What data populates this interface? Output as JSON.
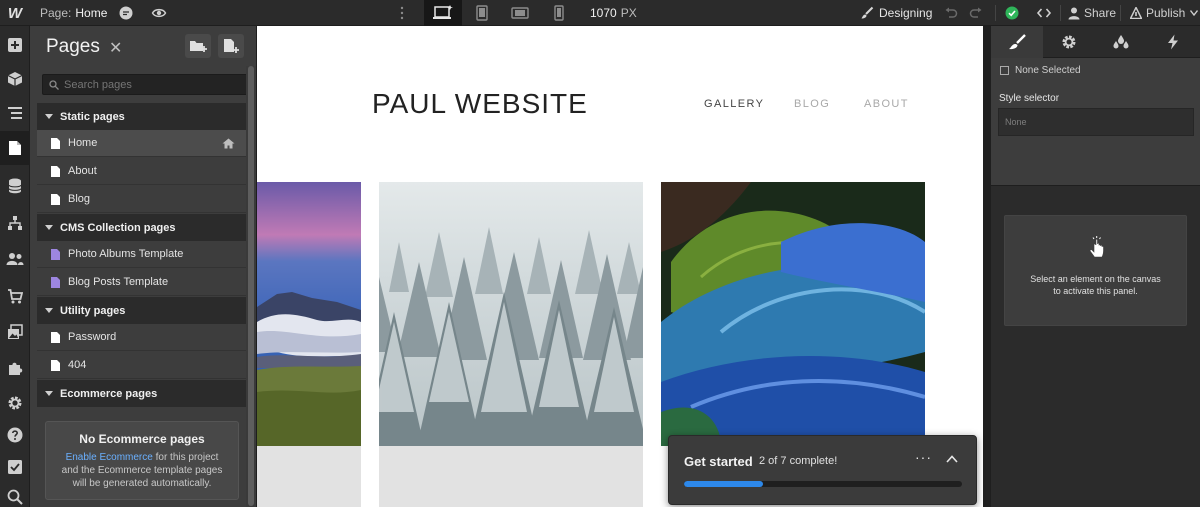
{
  "topbar": {
    "logo": "W",
    "page_prefix": "Page:",
    "page_name": "Home",
    "canvas_width": "1070",
    "canvas_unit": "PX",
    "mode_label": "Designing",
    "share_label": "Share",
    "publish_label": "Publish"
  },
  "pages_panel": {
    "title": "Pages",
    "close_glyph": "✕",
    "search_placeholder": "Search pages",
    "sections": {
      "static": {
        "label": "Static pages",
        "items": [
          "Home",
          "About",
          "Blog"
        ]
      },
      "cms": {
        "label": "CMS Collection pages",
        "items": [
          "Photo Albums Template",
          "Blog Posts Template"
        ]
      },
      "utility": {
        "label": "Utility pages",
        "items": [
          "Password",
          "404"
        ]
      },
      "ecommerce": {
        "label": "Ecommerce pages"
      }
    },
    "ecommerce_box": {
      "title": "No Ecommerce pages",
      "link": "Enable Ecommerce",
      "text_after_link": " for this project",
      "text_line2": "and the Ecommerce template pages",
      "text_line3": "will be generated automatically."
    }
  },
  "canvas": {
    "site_title": "PAUL WEBSITE",
    "nav": [
      "GALLERY",
      "BLOG",
      "ABOUT"
    ]
  },
  "style_panel": {
    "none_selected": "None Selected",
    "style_selector_label": "Style selector",
    "style_selector_value": "None",
    "empty_message_line1": "Select an element on the canvas",
    "empty_message_line2": "to activate this panel."
  },
  "get_started": {
    "title": "Get started",
    "progress_text": "2 of 7 complete!",
    "progress_fraction": 0.2857,
    "more_glyph": "···"
  },
  "colors": {
    "accent_blue": "#2d88ea",
    "status_green": "#2fb55a",
    "cms_page_icon": "#9d86e0"
  }
}
